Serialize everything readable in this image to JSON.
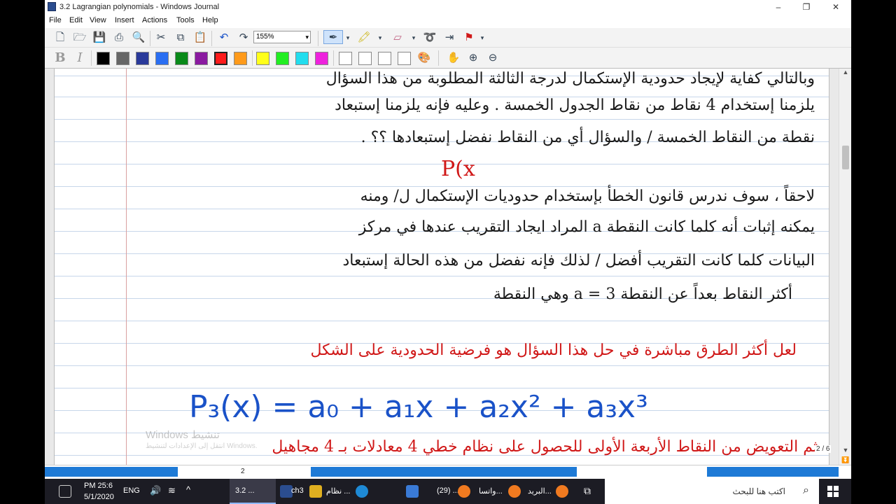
{
  "window": {
    "title": "3.2 Lagrangian polynomials - Windows Journal",
    "minimize": "–",
    "maximize": "❐",
    "close": "✕"
  },
  "menu": [
    "File",
    "Edit",
    "View",
    "Insert",
    "Actions",
    "Tools",
    "Help"
  ],
  "toolbar": {
    "zoom_value": "155%"
  },
  "colors": {
    "swatches": [
      "#000000",
      "#666666",
      "#2a3a9a",
      "#2a6ef2",
      "#0a8a1a",
      "#8a1aa0",
      "#ff1a1a",
      "#ff9a1a",
      "#ffff1a",
      "#22ee22",
      "#22ddee",
      "#ee22dd",
      "#ffffff",
      "#ffffff",
      "#ffffff",
      "#ffffff"
    ],
    "ink_black": "#1a1a1a",
    "ink_red": "#d01818",
    "ink_blue": "#1a52c8"
  },
  "notes": {
    "line1": "وبالتالي كفاية لإيجاد حدودية الإستكمال لدرجة الثالثة المطلوبة من هذا السؤال",
    "line2": "يلزمنا إستخدام 4 نقاط من نقاط الجدول الخمسة . وعليه فإنه يلزمنا إستبعاد",
    "line3": "نقطة من النقاط الخمسة / والسؤال أي من النقاط نفضل إستبعادها ؟؟ .",
    "red_small": "P(x",
    "line4": "لاحقاً ، سوف ندرس قانون الخطأ بإستخدام حدوديات الإستكمال ل/ ومنه",
    "line5": "يمكنه إثبات أنه كلما كانت النقطة a المراد ايجاد التقريب عندها في مركز",
    "line6": "البيانات كلما كانت التقريب أفضل / لذلك فإنه نفضل من هذه الحالة إستبعاد",
    "line7": "أكثر النقاط بعداً عن النقطة a = 3 وهي النقطة",
    "red_line1": "لعل أكثر الطرق مباشرة في حل هذا السؤال هو فرضية الحدودية على الشكل",
    "formula": "P₃(x) = a₀ + a₁x + a₂x² + a₃x³",
    "red_line2": "ثم التعويض من النقاط الأربعة الأولى للحصول على نظام خطي 4 معادلات بـ 4 مجاهيل"
  },
  "watermark": {
    "line1": "Windows تنشيط",
    "line2": "انتقل إلى الإعدادات لتنشيط Windows."
  },
  "page_indicator": "2 / 6",
  "page_number": "2",
  "taskbar": {
    "time": "PM 25:6",
    "date": "5/1/2020",
    "lang": "ENG",
    "tasks": [
      "3.2 ...",
      "ch3",
      "نظام ...",
      "(29) ...",
      "واتسا...",
      "البريد..."
    ],
    "search_placeholder": "اكتب هنا للبحث"
  }
}
